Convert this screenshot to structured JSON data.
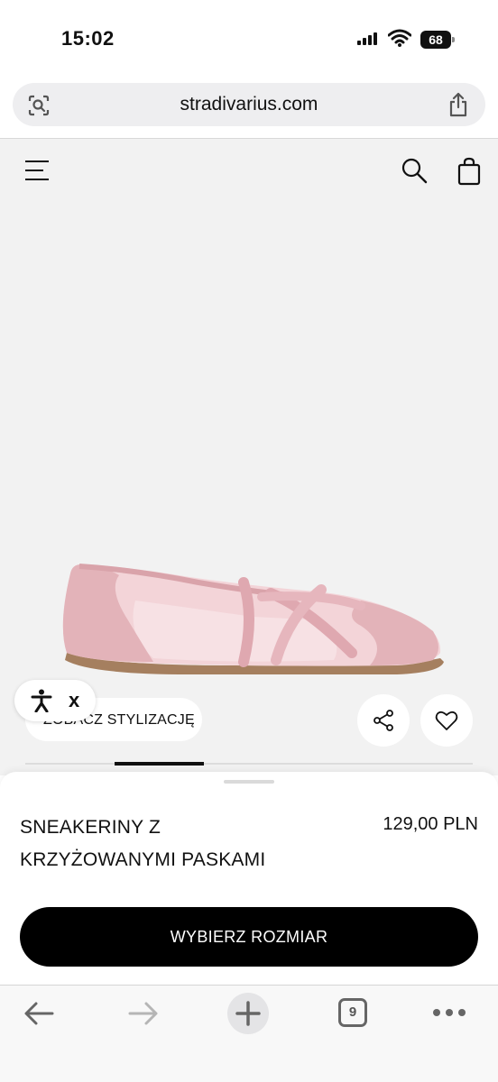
{
  "status_bar": {
    "time": "15:02",
    "battery": "68"
  },
  "browser": {
    "url": "stradivarius.com",
    "tab_count": "9"
  },
  "product": {
    "stylization_label": "ZOBACZ STYLIZACJĘ",
    "name_line1": "SNEAKERINY Z",
    "name_line2": "KRZYŻOWANYMI PASKAMI",
    "price": "129,00 PLN",
    "cta_label": "WYBIERZ ROZMIAR",
    "gallery_progress": 0.2
  },
  "accessibility": {
    "close_label": "x"
  },
  "colors": {
    "shoe_pink": "#e9bcc2",
    "background": "#f2f2f2",
    "cta": "#000000"
  },
  "icons": [
    "signal-icon",
    "wifi-icon",
    "battery-icon",
    "lens-icon",
    "share-icon",
    "menu-icon",
    "search-icon",
    "bag-icon",
    "accessibility-icon",
    "heart-icon",
    "back-arrow-icon",
    "forward-arrow-icon",
    "plus-icon",
    "tabs-icon",
    "more-icon"
  ]
}
